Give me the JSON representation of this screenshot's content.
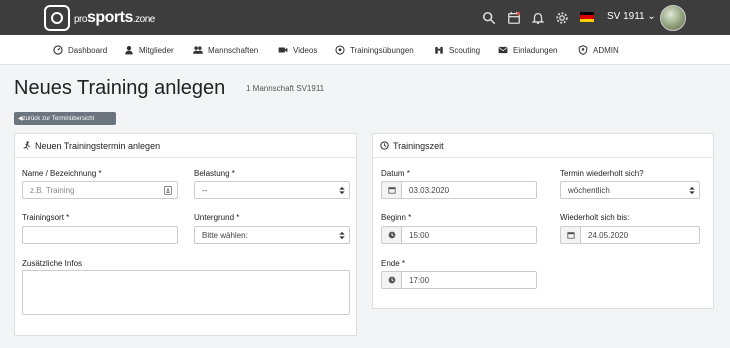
{
  "app": {
    "logo_prefix": "pro",
    "logo_main": "sports",
    "logo_suffix": ".zone",
    "club_name": "SV 1911",
    "flag_colors": [
      "#000000",
      "#dd0000",
      "#ffce00"
    ]
  },
  "nav": {
    "items": [
      {
        "label": "Dashboard",
        "icon": "dashboard-icon"
      },
      {
        "label": "Mitglieder",
        "icon": "user-icon"
      },
      {
        "label": "Mannschaften",
        "icon": "users-icon"
      },
      {
        "label": "Videos",
        "icon": "video-icon"
      },
      {
        "label": "Trainingsübungen",
        "icon": "soccer-ball-icon"
      },
      {
        "label": "Scouting",
        "icon": "binoculars-icon"
      },
      {
        "label": "Einladungen",
        "icon": "envelope-icon"
      },
      {
        "label": "ADMIN",
        "icon": "admin-icon"
      }
    ]
  },
  "page": {
    "title": "Neues Training anlegen",
    "subtitle": "1 Mannschaft SV1911",
    "back_label": "zurück zur Terminübersicht"
  },
  "left_card": {
    "title": "Neuen Trainingstermin anlegen",
    "name_label": "Name / Bezeichnung *",
    "name_placeholder": "z.B. Training",
    "belastung_label": "Belastung *",
    "belastung_value": "--",
    "ort_label": "Trainingsort *",
    "ort_value": "",
    "untergrund_label": "Untergrund *",
    "untergrund_value": "Bitte wählen:",
    "infos_label": "Zusätzliche Infos",
    "infos_value": ""
  },
  "right_card": {
    "title": "Trainingszeit",
    "datum_label": "Datum *",
    "datum_value": "03.03.2020",
    "wiederholt_label": "Termin wiederholt sich?",
    "wiederholt_value": "wöchentlich",
    "beginn_label": "Beginn *",
    "beginn_value": "15:00",
    "bis_label": "Wiederholt sich bis:",
    "bis_value": "24.05.2020",
    "ende_label": "Ende *",
    "ende_value": "17:00"
  }
}
